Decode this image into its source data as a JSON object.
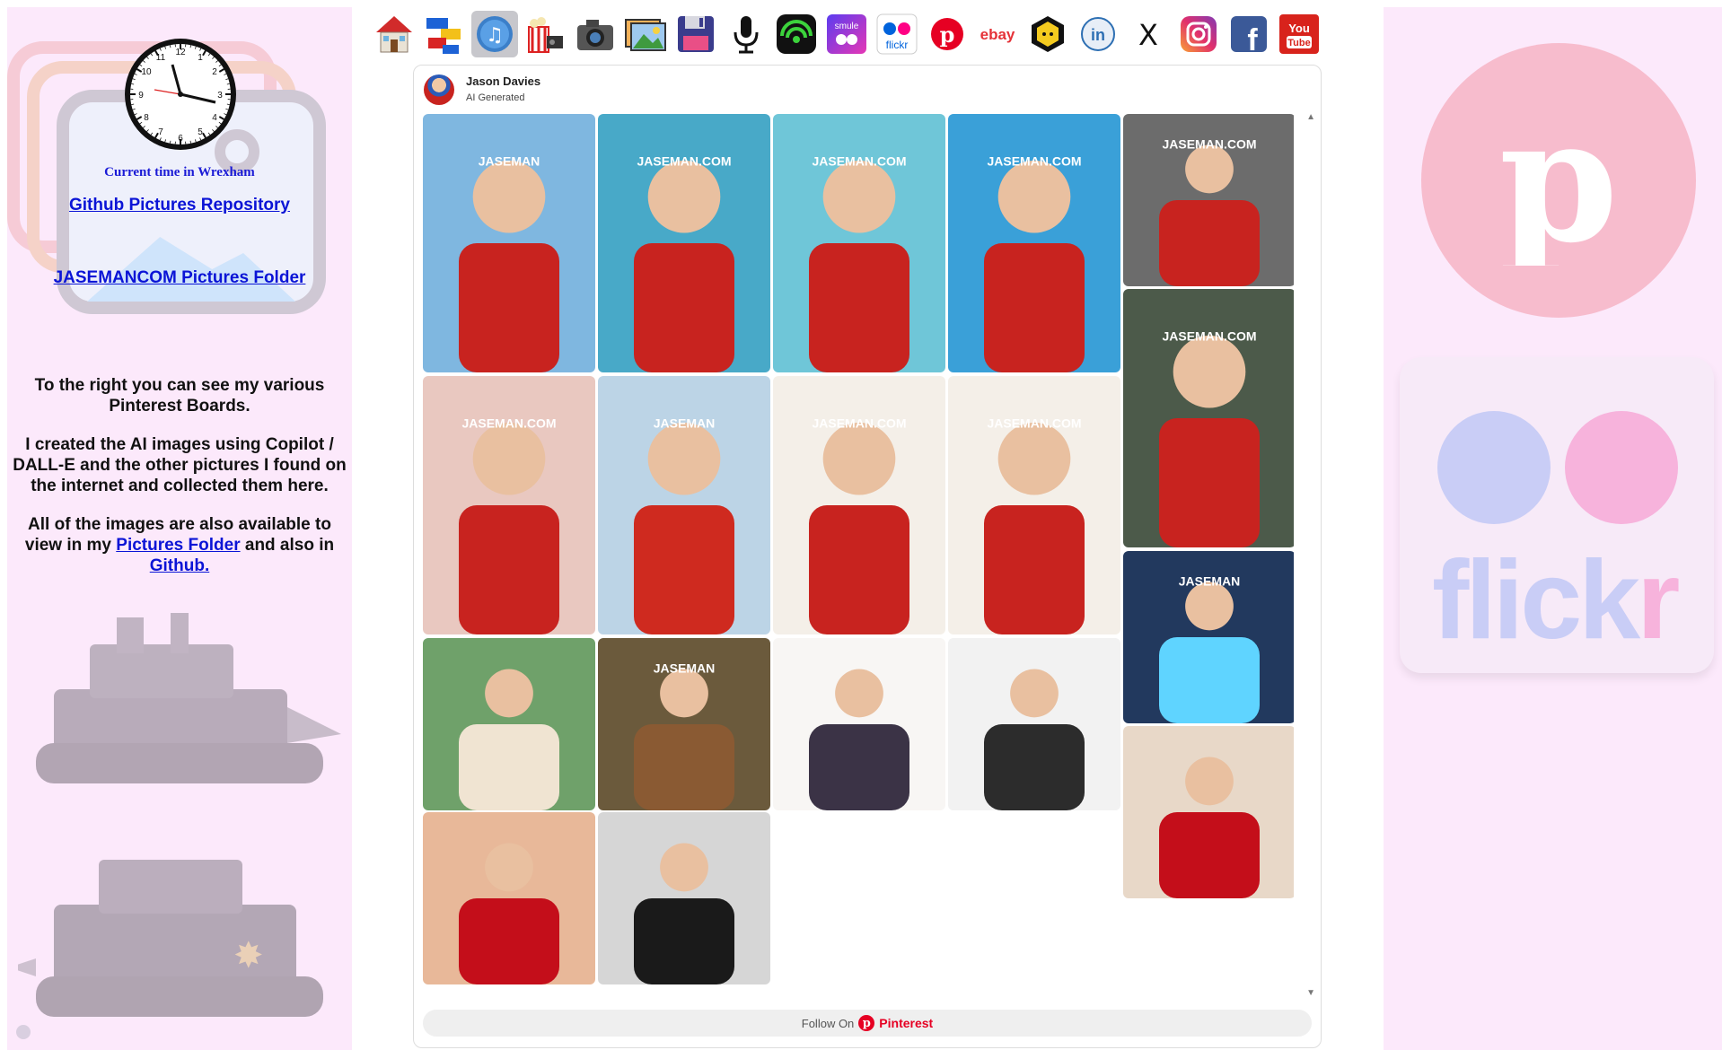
{
  "left": {
    "clock_caption": "Current time in Wrexham",
    "github_link": "Github Pictures Repository",
    "folder_link": "JASEMANCOM Pictures Folder",
    "para1": "To the right you can see my various Pinterest Boards.",
    "para2": "I created the AI images using Copilot / DALL-E and the other pictures I found on the internet and collected them here.",
    "para3_prefix": "All of the images are also available to view in my",
    "para3_link1": "Pictures Folder",
    "para3_mid": "and also in",
    "para3_link2": "Github."
  },
  "topbar": {
    "icons": [
      "home-icon",
      "lego-icon",
      "music-icon",
      "movies-icon",
      "camera-icon",
      "pictures-icon",
      "floppy-disk-icon",
      "microphone-icon",
      "podcast-icon",
      "smule-icon",
      "flickr-icon",
      "pinterest-icon",
      "ebay-icon",
      "hexagon-app-icon",
      "linkedin-icon",
      "x-icon",
      "instagram-icon",
      "facebook-icon",
      "youtube-icon"
    ],
    "ebay_label": "ebay",
    "flickr_label": "flickr",
    "youtube_label": "You Tube",
    "linkedin_label": "in",
    "x_label": "X",
    "facebook_label": "f",
    "smule_label": "smule"
  },
  "widget": {
    "profile_name": "Jason Davies",
    "board_name": "AI Generated",
    "follow_prefix": "Follow On",
    "follow_brand": "Pinterest",
    "pins": [
      {
        "name": "pin-jet-trio",
        "bg": "#7fb7e0",
        "fg": "#c8231f",
        "text": "JASEMAN"
      },
      {
        "name": "pin-beach-water",
        "bg": "#48a9c8",
        "fg": "#c8231f",
        "text": "JASEMAN.COM"
      },
      {
        "name": "pin-boardwalk",
        "bg": "#6fc6d8",
        "fg": "#c8231f",
        "text": "JASEMAN.COM"
      },
      {
        "name": "pin-man-palms",
        "bg": "#3aa0d8",
        "fg": "#c8231f",
        "text": "JASEMAN.COM"
      },
      {
        "name": "pin-salute-war",
        "bg": "#6c6c6c",
        "fg": "#c8231f",
        "text": "JASEMAN.COM"
      },
      {
        "name": "pin-tank-portrait",
        "bg": "#4c5a4a",
        "fg": "#c8231f",
        "text": "JASEMAN.COM"
      },
      {
        "name": "pin-bedroom",
        "bg": "#e9c8c0",
        "fg": "#c8231f",
        "text": "JASEMAN.COM"
      },
      {
        "name": "pin-jaseman-poster",
        "bg": "#bcd4e6",
        "fg": "#cf2a1f",
        "text": "JASEMAN"
      },
      {
        "name": "pin-cartoon-smile",
        "bg": "#f4efe8",
        "fg": "#c8231f",
        "text": "JASEMAN.COM"
      },
      {
        "name": "pin-cartoon-frown",
        "bg": "#f4efe8",
        "fg": "#c8231f",
        "text": "JASEMAN.COM"
      },
      {
        "name": "pin-blue-emblem",
        "bg": "#22395e",
        "fg": "#5fd4ff",
        "text": "JASEMAN"
      },
      {
        "name": "pin-meadow-woman",
        "bg": "#6fa16a",
        "fg": "#f0e4d2",
        "text": ""
      },
      {
        "name": "pin-wood-jaseman",
        "bg": "#6b5a3c",
        "fg": "#8a5a33",
        "text": "JASEMAN"
      },
      {
        "name": "pin-anime-face",
        "bg": "#f8f6f4",
        "fg": "#3b3346",
        "text": ""
      },
      {
        "name": "pin-sketch-face",
        "bg": "#f2f2f2",
        "fg": "#2c2c2c",
        "text": ""
      },
      {
        "name": "pin-red-lips-drip",
        "bg": "#e8d8c8",
        "fg": "#c40e1a",
        "text": ""
      },
      {
        "name": "pin-red-lips",
        "bg": "#e8b899",
        "fg": "#c40e1a",
        "text": ""
      },
      {
        "name": "pin-bw-sunglasses",
        "bg": "#d6d6d6",
        "fg": "#1a1a1a",
        "text": ""
      }
    ]
  },
  "right": {
    "flickr_word_a": "flick",
    "flickr_word_b": "r"
  },
  "colors": {
    "panel": "#fce9fb",
    "link": "#0b14d6",
    "pinterest": "#e60023"
  }
}
